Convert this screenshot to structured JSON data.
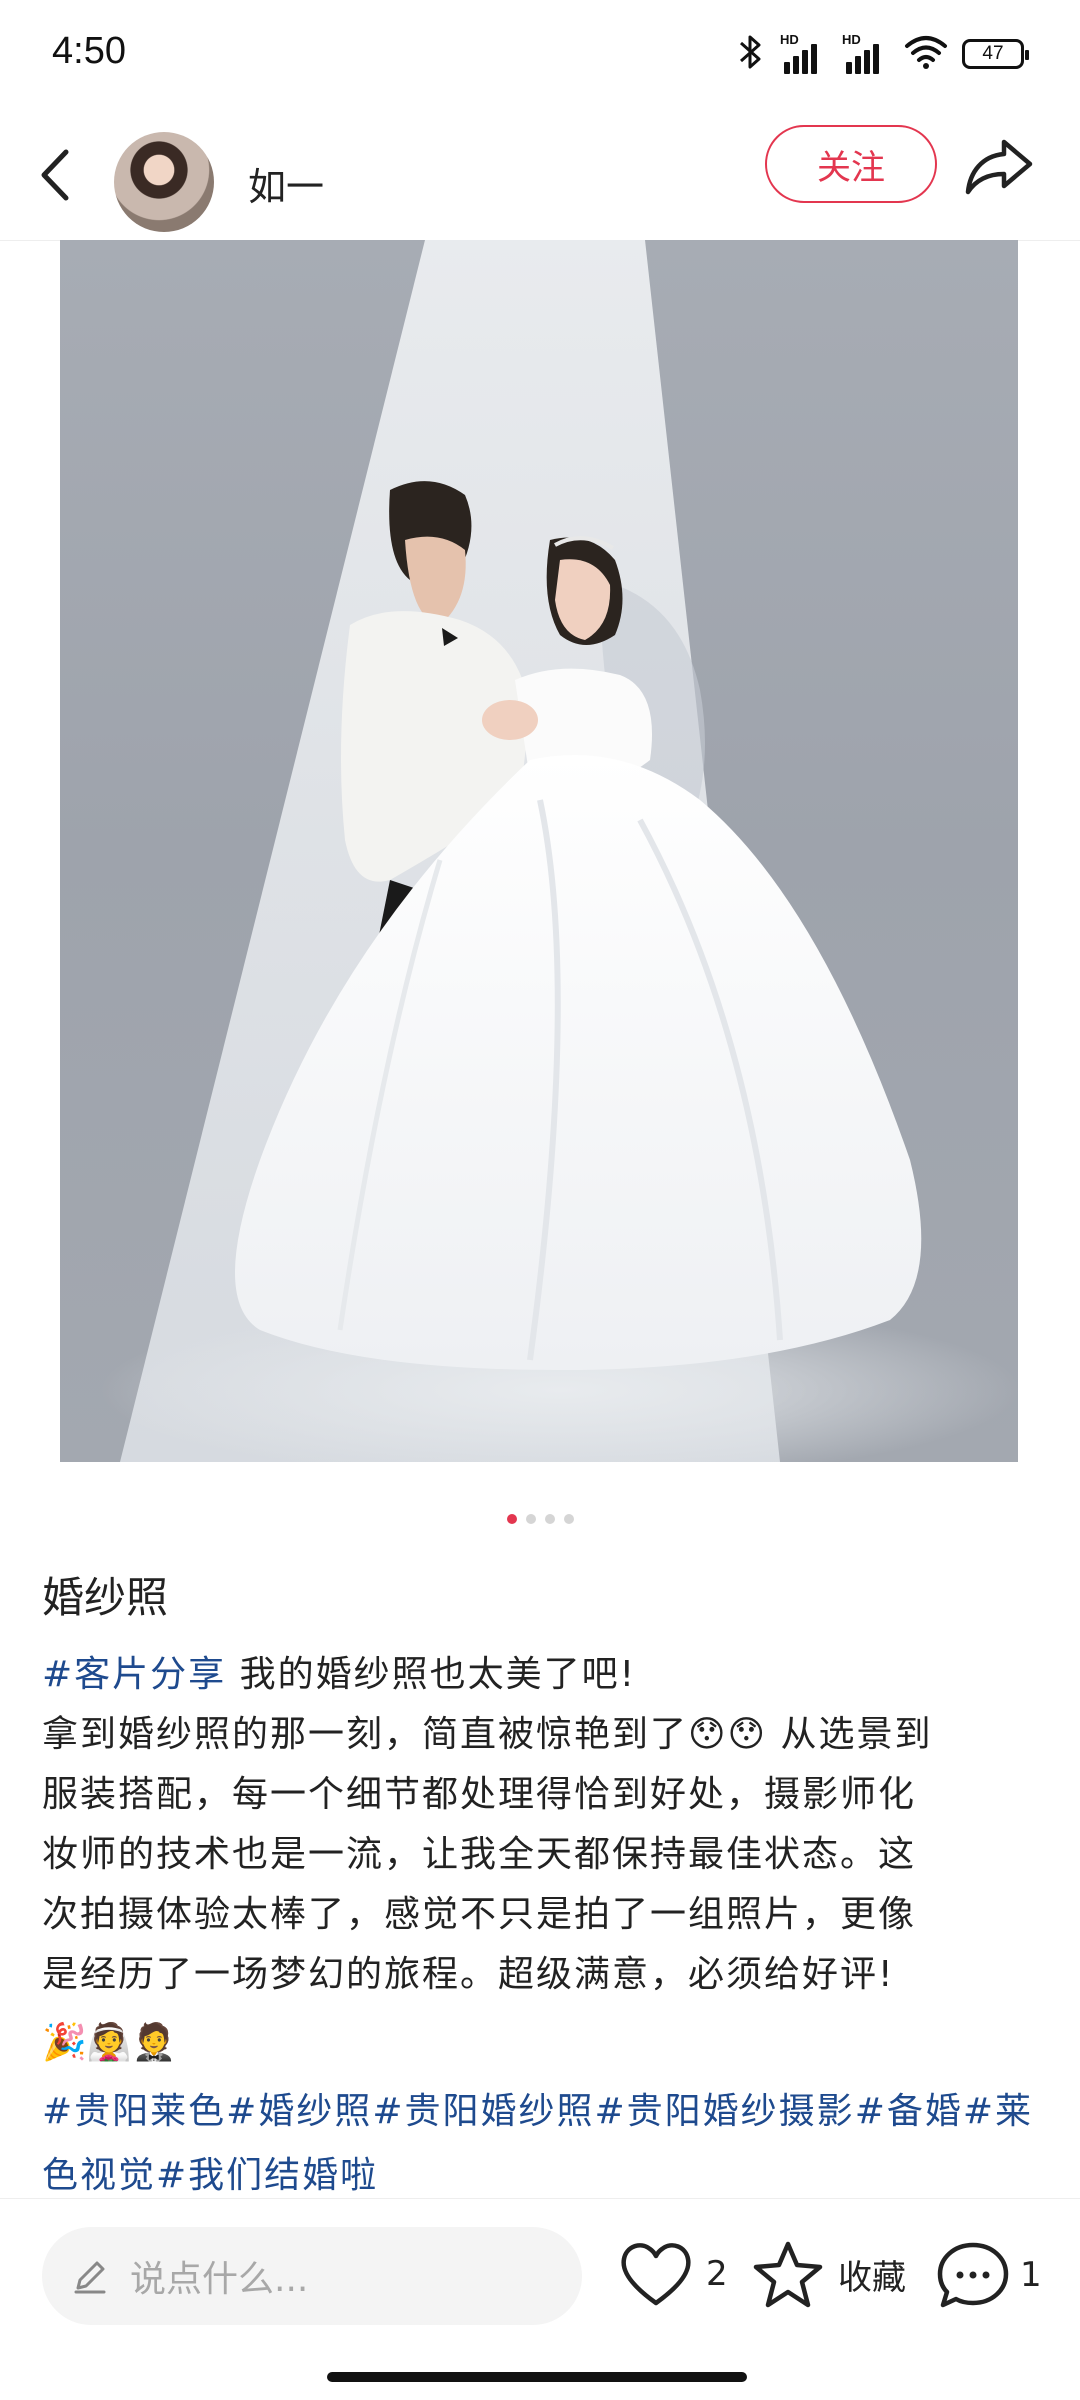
{
  "status_bar": {
    "time": "4:50",
    "signal_labels": [
      "HD",
      "HD"
    ],
    "battery": "47"
  },
  "header": {
    "username": "如一",
    "follow_label": "关注"
  },
  "carousel": {
    "total_pages": 4,
    "current_page": 1
  },
  "post": {
    "title": "婚纱照",
    "first_tag": "#客片分享",
    "first_line": " 我的婚纱照也太美了吧!",
    "body_lines": [
      "拿到婚纱照的那一刻，简直被惊艳到了😯😯 从选景到",
      "服装搭配，每一个细节都处理得恰到好处，摄影师化",
      "妆师的技术也是一流，让我全天都保持最佳状态。这",
      "次拍摄体验太棒了，感觉不只是拍了一组照片，更像",
      "是经历了一场梦幻的旅程。超级满意，必须给好评!"
    ],
    "emoji_line": "🎉👰🤵",
    "tags": [
      "#贵阳莱色",
      "#婚纱照",
      "#贵阳婚纱照",
      "#贵阳婚纱摄影",
      "#备婚",
      "#莱色视觉",
      "#我们结婚啦"
    ]
  },
  "bottom_bar": {
    "comment_placeholder": "说点什么...",
    "like_count": "2",
    "collect_label": "收藏",
    "comment_count": "1"
  },
  "colors": {
    "accent": "#e3364f",
    "tag_blue": "#1e4a8e"
  }
}
